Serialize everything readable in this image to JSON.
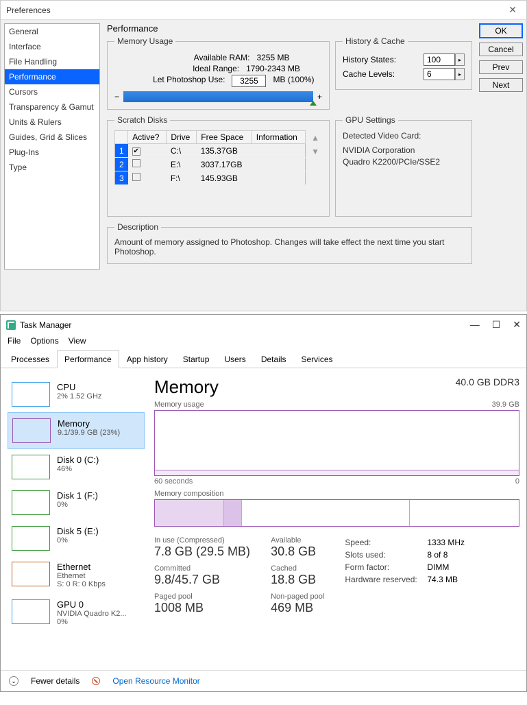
{
  "ps": {
    "title": "Preferences",
    "sidebar": [
      "General",
      "Interface",
      "File Handling",
      "Performance",
      "Cursors",
      "Transparency & Gamut",
      "Units & Rulers",
      "Guides, Grid & Slices",
      "Plug-Ins",
      "Type"
    ],
    "selected_index": 3,
    "section_title": "Performance",
    "mem": {
      "legend": "Memory Usage",
      "available_label": "Available RAM:",
      "available_value": "3255 MB",
      "ideal_label": "Ideal Range:",
      "ideal_value": "1790-2343 MB",
      "let_label": "Let Photoshop Use:",
      "let_value": "3255",
      "let_suffix": "MB (100%)"
    },
    "history": {
      "legend": "History & Cache",
      "states_label": "History States:",
      "states_value": "100",
      "cache_label": "Cache Levels:",
      "cache_value": "6"
    },
    "buttons": {
      "ok": "OK",
      "cancel": "Cancel",
      "prev": "Prev",
      "next": "Next"
    },
    "scratch": {
      "legend": "Scratch Disks",
      "headers": [
        "",
        "Active?",
        "Drive",
        "Free Space",
        "Information"
      ],
      "rows": [
        {
          "n": "1",
          "active": true,
          "drive": "C:\\",
          "free": "135.37GB"
        },
        {
          "n": "2",
          "active": false,
          "drive": "E:\\",
          "free": "3037.17GB"
        },
        {
          "n": "3",
          "active": false,
          "drive": "F:\\",
          "free": "145.93GB"
        }
      ]
    },
    "gpu": {
      "legend": "GPU Settings",
      "detected_label": "Detected Video Card:",
      "vendor": "NVIDIA Corporation",
      "card": "Quadro K2200/PCIe/SSE2"
    },
    "desc": {
      "legend": "Description",
      "text": "Amount of memory assigned to Photoshop. Changes will take effect the next time you start Photoshop."
    }
  },
  "tm": {
    "title": "Task Manager",
    "menu": [
      "File",
      "Options",
      "View"
    ],
    "tabs": [
      "Processes",
      "Performance",
      "App history",
      "Startup",
      "Users",
      "Details",
      "Services"
    ],
    "active_tab": 1,
    "side": [
      {
        "title": "CPU",
        "sub": "2%  1.52 GHz",
        "color": "#3aa0e8"
      },
      {
        "title": "Memory",
        "sub": "9.1/39.9 GB (23%)",
        "color": "#9b59b6"
      },
      {
        "title": "Disk 0 (C:)",
        "sub": "46%",
        "color": "#3a9a3a"
      },
      {
        "title": "Disk 1 (F:)",
        "sub": "0%",
        "color": "#3a9a3a"
      },
      {
        "title": "Disk 5 (E:)",
        "sub": "0%",
        "color": "#3a9a3a"
      },
      {
        "title": "Ethernet",
        "sub": "Ethernet",
        "sub2": "S: 0  R: 0 Kbps",
        "color": "#c06020"
      },
      {
        "title": "GPU 0",
        "sub": "NVIDIA Quadro K2...",
        "sub2": "0%",
        "color": "#3aa0e8"
      }
    ],
    "side_selected": 1,
    "main": {
      "heading": "Memory",
      "total": "40.0 GB DDR3",
      "usage_label": "Memory usage",
      "usage_max": "39.9 GB",
      "xaxis_left": "60 seconds",
      "xaxis_right": "0",
      "comp_label": "Memory composition",
      "stats": {
        "in_use_l": "In use (Compressed)",
        "in_use_v": "7.8 GB (29.5 MB)",
        "avail_l": "Available",
        "avail_v": "30.8 GB",
        "commit_l": "Committed",
        "commit_v": "9.8/45.7 GB",
        "cached_l": "Cached",
        "cached_v": "18.8 GB",
        "paged_l": "Paged pool",
        "paged_v": "1008 MB",
        "nonpaged_l": "Non-paged pool",
        "nonpaged_v": "469 MB"
      },
      "kv": {
        "speed_k": "Speed:",
        "speed_v": "1333 MHz",
        "slots_k": "Slots used:",
        "slots_v": "8 of 8",
        "form_k": "Form factor:",
        "form_v": "DIMM",
        "hwres_k": "Hardware reserved:",
        "hwres_v": "74.3 MB"
      }
    },
    "footer": {
      "fewer": "Fewer details",
      "resmon": "Open Resource Monitor"
    }
  }
}
